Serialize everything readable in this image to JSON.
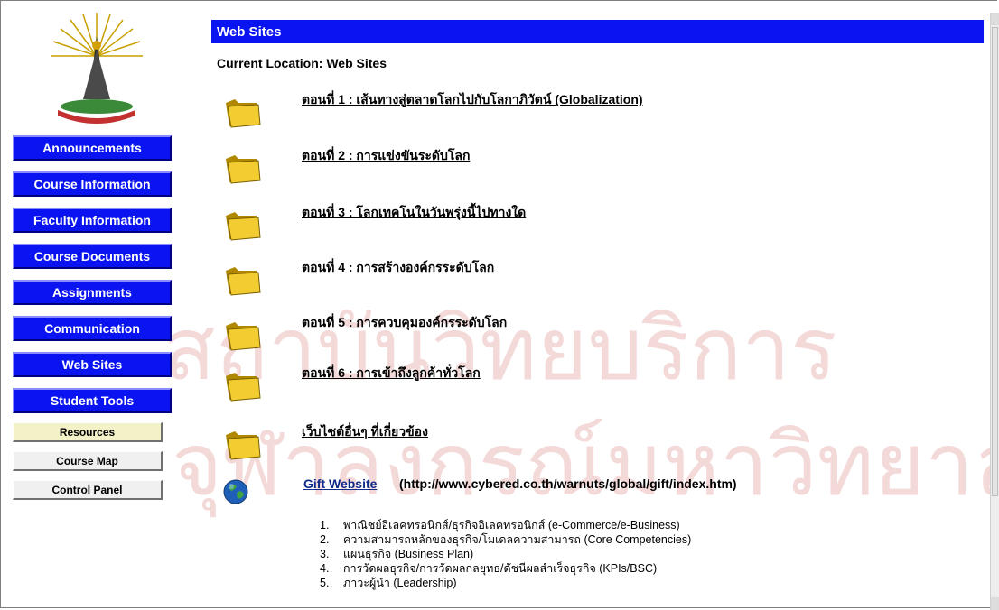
{
  "nav": {
    "buttons": [
      "Announcements",
      "Course Information",
      "Faculty Information",
      "Course Documents",
      "Assignments",
      "Communication",
      "Web Sites",
      "Student Tools"
    ],
    "sub_buttons": [
      "Resources",
      "Course Map",
      "Control Panel"
    ]
  },
  "header": {
    "title": "Web Sites"
  },
  "location": "Current Location: Web Sites",
  "folders": [
    "ตอนที่ 1 : เส้นทางสู่ตลาดโลกไปกับโลกาภิวัตน์ (Globalization)",
    "ตอนที่ 2 : การแข่งขันระดับโลก",
    "ตอนที่ 3 : โลกเทคโนในวันพรุ่งนี้ไปทางใด",
    "ตอนที่ 4 : การสร้างองค์กรระดับโลก",
    "ตอนที่ 5 : การควบคุมองค์กรระดับโลก",
    "ตอนที่ 6 : การเข้าถึงลูกค้าทั่วโลก",
    "เว็บไซต์อื่นๆ ที่เกี่ยวข้อง"
  ],
  "gift": {
    "link": "Gift Website",
    "url": "(http://www.cybered.co.th/warnuts/global/gift/index.htm)"
  },
  "topics": [
    {
      "num": "1.",
      "text": "พาณิชย์อิเลคทรอนิกส์/ธุรกิจอิเลคทรอนิกส์ (e-Commerce/e-Business)"
    },
    {
      "num": "2.",
      "text": "ความสามารถหลักของธุรกิจ/โมเดลความสามารถ (Core Competencies)"
    },
    {
      "num": "3.",
      "text": "แผนธุรกิจ (Business Plan)"
    },
    {
      "num": "4.",
      "text": "การวัดผลธุรกิจ/การวัดผลกลยุทธ/ดัชนีผลสำเร็จธุรกิจ (KPIs/BSC)"
    },
    {
      "num": "5.",
      "text": "ภาวะผู้นำ (Leadership)"
    }
  ],
  "watermark": {
    "line1": "สถาบันวิทยบริการ",
    "line2": "จุฬาลงกรณ์มหาวิทยาลัย",
    "color": "#f4d9d9"
  },
  "colors": {
    "accent": "#0a14f0",
    "folder": "#e0b820",
    "link": "#0f2a8a"
  },
  "icons": {
    "folder": "folder-icon",
    "globe": "globe-icon",
    "logo": "university-emblem"
  }
}
